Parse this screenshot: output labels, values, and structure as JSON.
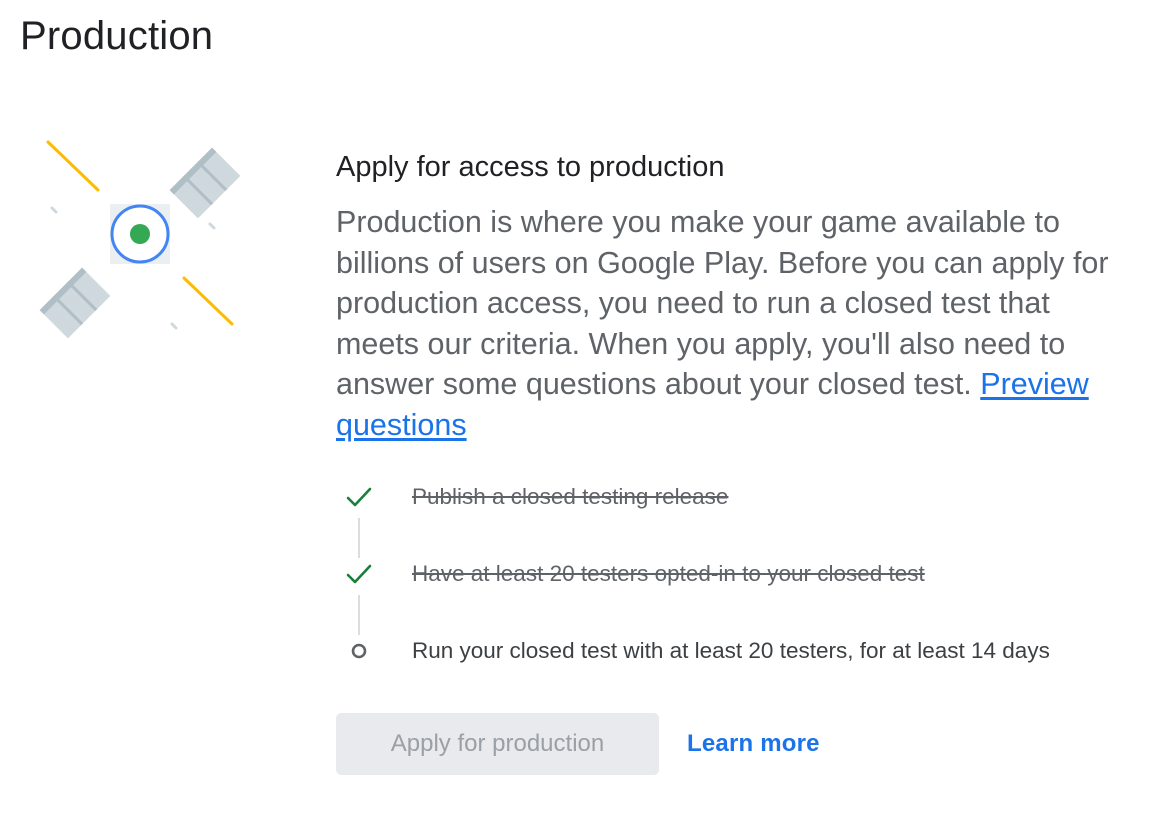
{
  "page": {
    "title": "Production"
  },
  "card": {
    "heading": "Apply for access to production",
    "description": "Production is where you make your game available to billions of users on Google Play. Before you can apply for production access, you need to run a closed test that meets our criteria. When you apply, you'll also need to answer some questions about your closed test.",
    "preview_link": "Preview questions"
  },
  "checklist": [
    {
      "text": "Publish a closed testing release",
      "status": "done",
      "icon": "check-icon"
    },
    {
      "text": "Have at least 20 testers opted-in to your closed test",
      "status": "done",
      "icon": "check-icon"
    },
    {
      "text": "Run your closed test with at least 20 testers, for at least 14 days",
      "status": "pending",
      "icon": "circle-outline-icon"
    }
  ],
  "actions": {
    "apply_label": "Apply for production",
    "apply_enabled": false,
    "learn_more_label": "Learn more"
  },
  "colors": {
    "accent": "#1a73e8",
    "success": "#188038",
    "satellite_panel": "#cfd8dc",
    "satellite_core": "#34a853",
    "satellite_ring": "#4285f4",
    "signal": "#fbbc04"
  }
}
